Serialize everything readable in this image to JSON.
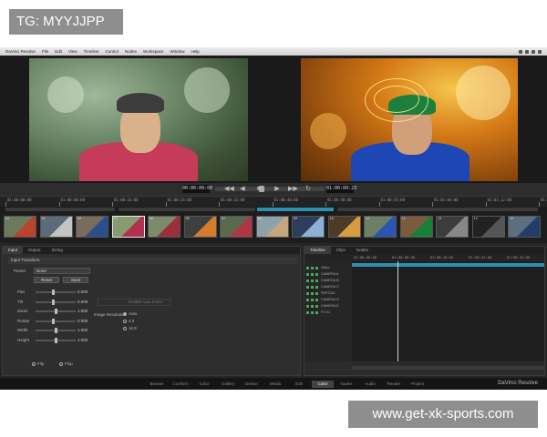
{
  "overlay": {
    "top_tag": "TG: MYYJJPP",
    "bottom_tag": "www.get-xk-sports.com"
  },
  "app": {
    "menu": [
      "DaVinci Resolve",
      "File",
      "Edit",
      "View",
      "Timeline",
      "Control",
      "Nodes",
      "Workspace",
      "Window",
      "Help"
    ],
    "brand": "DaVinci Resolve"
  },
  "transport": {
    "timecode_left": "00:00:00:00",
    "timecode_right": "01:00:00:23"
  },
  "ruler": {
    "ticks": [
      "01:00:00:00",
      "01:00:08:00",
      "01:00:16:00",
      "01:00:24:00",
      "01:00:32:00",
      "01:00:40:00",
      "01:00:48:00",
      "01:00:56:00",
      "01:01:04:00",
      "01:01:12:00",
      "01:01:20:00"
    ]
  },
  "thumbnails": {
    "labels": [
      "01",
      "02",
      "03",
      "04",
      "05",
      "06",
      "07",
      "08",
      "09",
      "10",
      "11",
      "12",
      "13",
      "14",
      "15"
    ],
    "selected_index": 3
  },
  "left_panel": {
    "tabs": [
      "Input",
      "Output",
      "Sizing"
    ],
    "section_title": "Input Transform",
    "preset_label": "Preset",
    "preset_value": "None",
    "reset_label": "Reset",
    "save_label": "Save",
    "params": [
      {
        "label": "Pan",
        "value": "0.000"
      },
      {
        "label": "Tilt",
        "value": "0.000"
      },
      {
        "label": "Zoom",
        "value": "1.000"
      },
      {
        "label": "Rotate",
        "value": "0.000"
      },
      {
        "label": "Width",
        "value": "1.000"
      },
      {
        "label": "Height",
        "value": "1.000"
      }
    ],
    "flip_h": "Flip",
    "flip_v": "Flop",
    "enable_label": "Enable Auto Zoom",
    "resize_label": "Image Resolution",
    "radio_options": [
      "Auto",
      "4:3",
      "16:9"
    ]
  },
  "right_panel": {
    "tabs": [
      "Timeline",
      "Clips",
      "Nodes"
    ],
    "timecodes": [
      "01:00:00:00",
      "01:00:08:00",
      "01:00:16:00",
      "01:00:24:00",
      "01:00:32:00"
    ],
    "tracks": [
      "Video",
      "CAMERA A",
      "CAMERA B",
      "CAMERA C",
      "SPECIAL",
      "CAMERA D",
      "CAMERA E",
      "FX 01"
    ]
  },
  "dock": {
    "tabs": [
      "Browse",
      "Conform",
      "Color",
      "Gallery",
      "Deliver",
      "Media",
      "Edit",
      "Color",
      "Nodes",
      "Audio",
      "Render",
      "Project"
    ],
    "active_index": 7
  }
}
